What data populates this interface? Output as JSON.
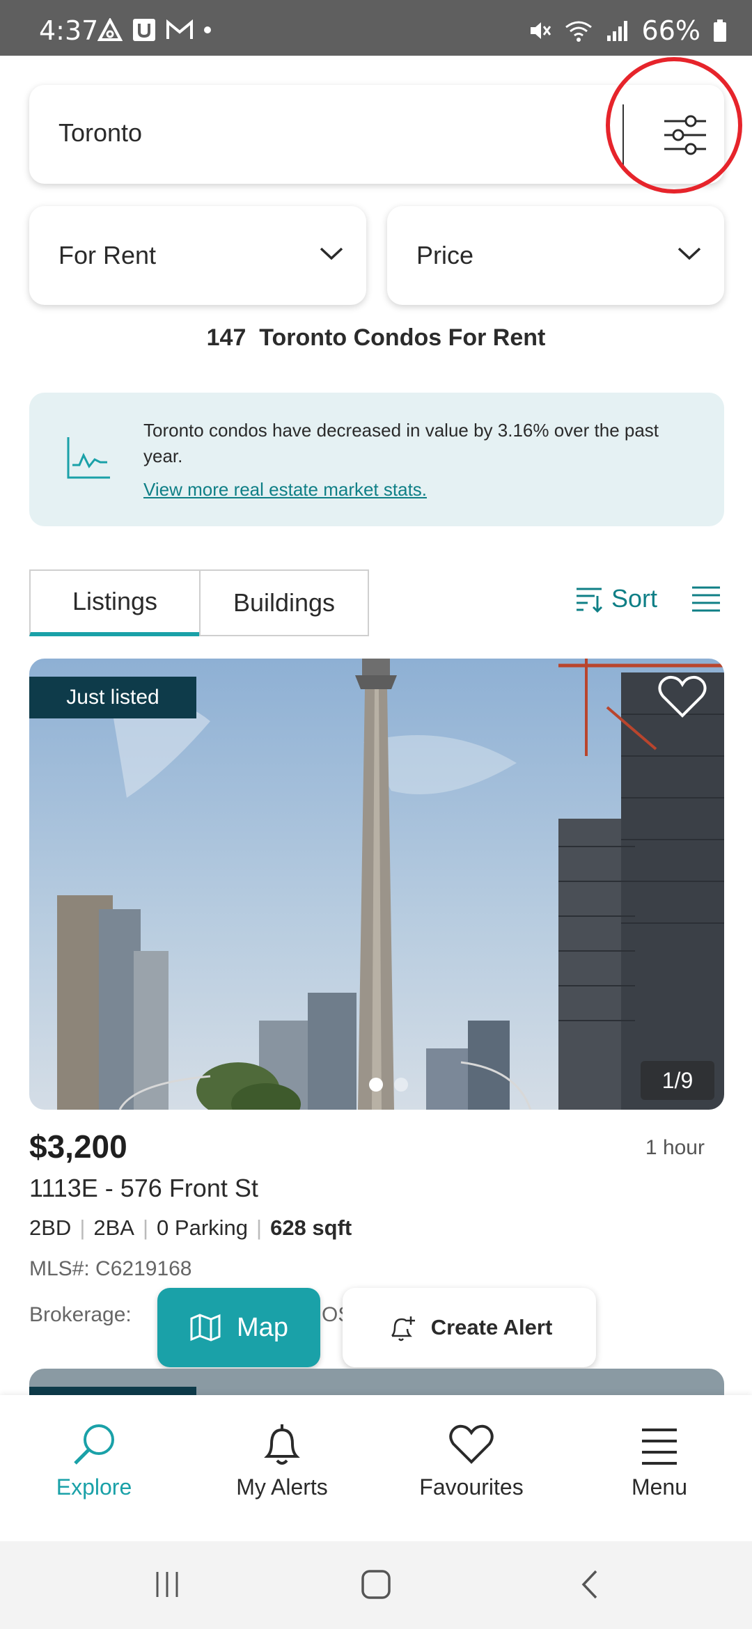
{
  "status_bar": {
    "time": "4:37",
    "battery": "66%"
  },
  "search": {
    "value": "Toronto"
  },
  "filters": {
    "listing_type": "For Rent",
    "price": "Price"
  },
  "results": {
    "count": "147",
    "title": "Toronto Condos For Rent"
  },
  "market_stats": {
    "text": "Toronto condos have decreased in value by 3.16% over the past year.",
    "link": "View more real estate market stats."
  },
  "tabs": {
    "listings": "Listings",
    "buildings": "Buildings"
  },
  "sort": {
    "label": "Sort"
  },
  "listing": {
    "badge": "Just listed",
    "photo_counter": "1/9",
    "price": "$3,200",
    "time": "1 hour",
    "address": "1113E - 576 Front St",
    "beds": "2BD",
    "baths": "2BA",
    "parking": "0 Parking",
    "area": "628 sqft",
    "mls": "MLS#: C6219168",
    "brokerage_label": "Brokerage:",
    "brokerage_fragment": "OS"
  },
  "floating": {
    "map": "Map",
    "create_alert": "Create Alert"
  },
  "bottom_nav": {
    "explore": "Explore",
    "alerts": "My Alerts",
    "favourites": "Favourites",
    "menu": "Menu"
  },
  "colors": {
    "accent": "#1aa1a8",
    "badge": "#0e3b4a",
    "stats_bg": "#e5f1f3",
    "highlight": "#e6242b"
  }
}
